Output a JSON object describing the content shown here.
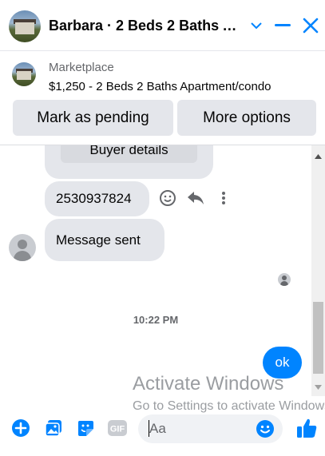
{
  "header": {
    "title": "Barbara · 2 Beds 2 Baths A...",
    "accent_color": "#0084ff",
    "buttons": [
      "chevron-down-icon",
      "minimize-icon",
      "close-icon"
    ]
  },
  "marketplace": {
    "label": "Marketplace",
    "listing": "$1,250 - 2 Beds 2 Baths Apartment/condo",
    "mark_pending_label": "Mark as pending",
    "more_options_label": "More options"
  },
  "chat": {
    "buyer_details_label": "Buyer details",
    "phone_message": "2530937824",
    "system_message": "Message sent",
    "timestamp": "10:22 PM",
    "outgoing_message": "ok"
  },
  "watermark": {
    "line1": "Activate Windows",
    "line2": "Go to Settings to activate Windows."
  },
  "composer": {
    "placeholder": "Aa",
    "gif_label": "GIF",
    "icons": [
      "plus-icon",
      "photo-icon",
      "sticker-icon",
      "gif-icon",
      "emoji-icon",
      "thumbs-up-icon"
    ]
  }
}
